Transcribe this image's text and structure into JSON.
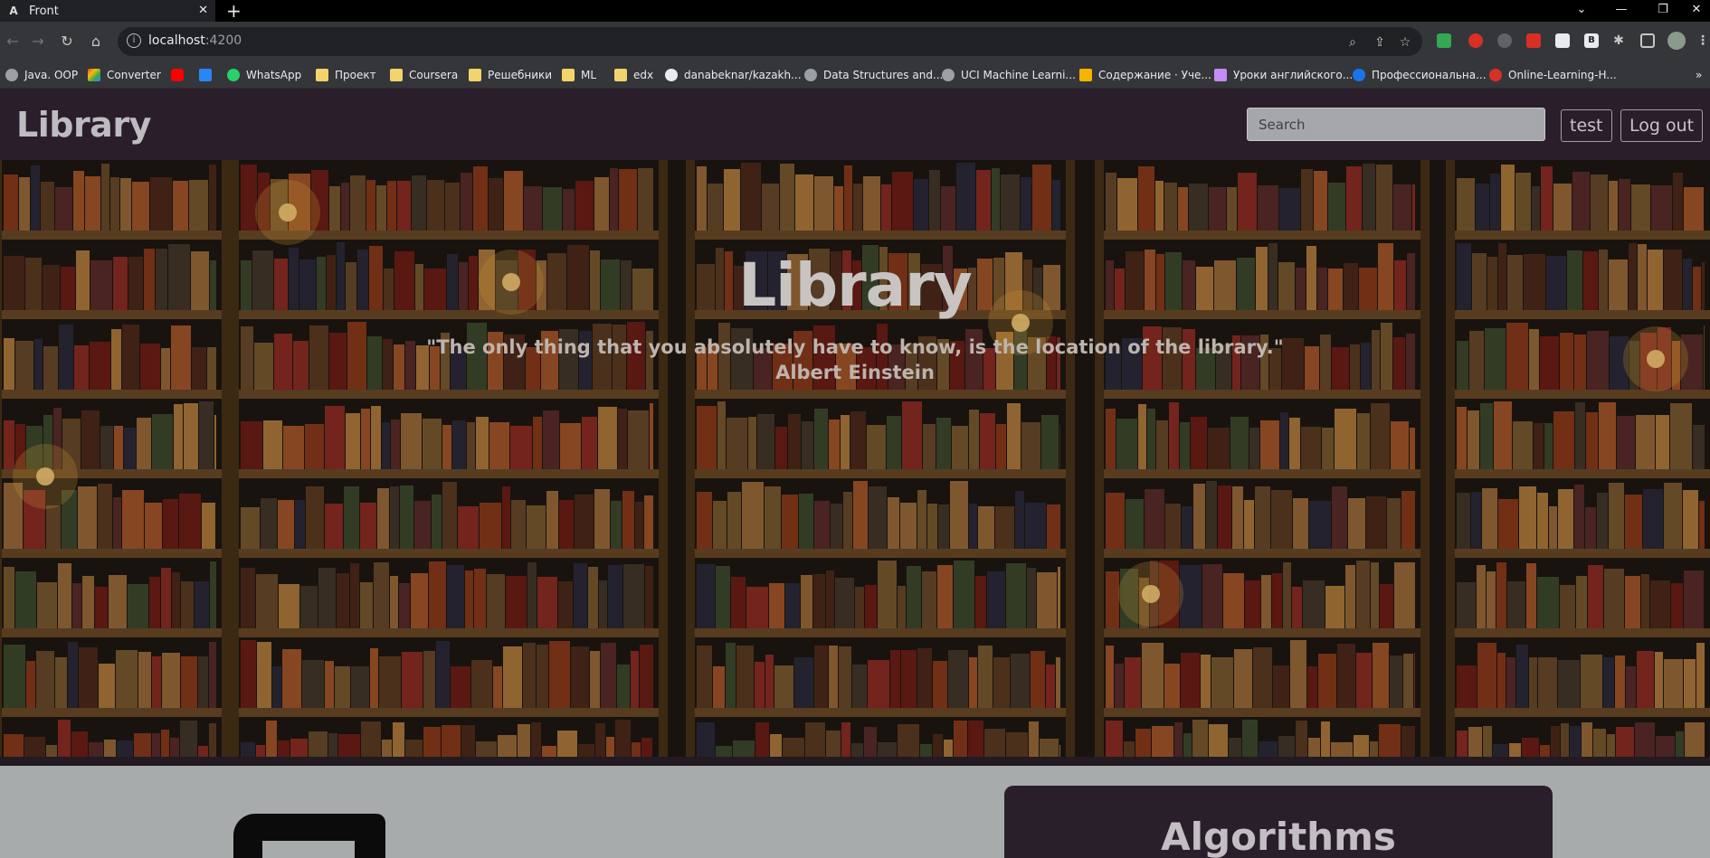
{
  "browser": {
    "tab_title": "Front",
    "tab_favicon": "A",
    "url_host": "localhost",
    "url_port": ":4200"
  },
  "bookmarks": [
    {
      "label": "Java. OOP",
      "icon": "globe-icon",
      "color": "#9aa0a6"
    },
    {
      "label": "Converter",
      "icon": "converter-icon",
      "color": "#f4b400"
    },
    {
      "label": "",
      "icon": "youtube-icon",
      "color": "#ff0000"
    },
    {
      "label": "",
      "icon": "vk-icon",
      "color": "#2787f5"
    },
    {
      "label": "WhatsApp",
      "icon": "whatsapp-icon",
      "color": "#25d366"
    },
    {
      "label": "Проект",
      "icon": "folder-icon",
      "color": "#f3d36b"
    },
    {
      "label": "Coursera",
      "icon": "folder-icon",
      "color": "#f3d36b"
    },
    {
      "label": "Решебники",
      "icon": "folder-icon",
      "color": "#f3d36b"
    },
    {
      "label": "ML",
      "icon": "folder-icon",
      "color": "#f3d36b"
    },
    {
      "label": "edx",
      "icon": "folder-icon",
      "color": "#f3d36b"
    },
    {
      "label": "danabeknar/kazakh...",
      "icon": "github-icon",
      "color": "#e8eaed"
    },
    {
      "label": "Data Structures and...",
      "icon": "globe-icon",
      "color": "#9aa0a6"
    },
    {
      "label": "UCI Machine Learni...",
      "icon": "globe-icon",
      "color": "#9aa0a6"
    },
    {
      "label": "Содержание · Уче...",
      "icon": "book-icon",
      "color": "#f4b400"
    },
    {
      "label": "Уроки английского...",
      "icon": "puzzle-icon",
      "color": "#c58af9"
    },
    {
      "label": "Профессиональна...",
      "icon": "c-icon",
      "color": "#1a73e8"
    },
    {
      "label": "Online-Learning-H...",
      "icon": "apple-icon",
      "color": "#d93025"
    }
  ],
  "site": {
    "brand": "Library",
    "search_placeholder": "Search",
    "user_button": "test",
    "logout_button": "Log out"
  },
  "hero": {
    "title": "Library",
    "quote": "\"The only thing that you absolutely have to know, is the location of the library.\"",
    "author": "Albert Einstein"
  },
  "card": {
    "title": "Algorithms"
  }
}
